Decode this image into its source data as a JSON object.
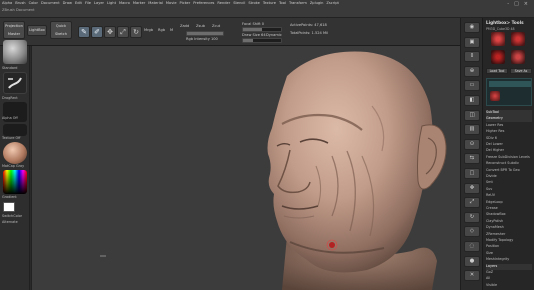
{
  "menubar": {
    "items": [
      "Alpha",
      "Brush",
      "Color",
      "Document",
      "Draw",
      "Edit",
      "File",
      "Layer",
      "Light",
      "Macro",
      "Marker",
      "Material",
      "Movie",
      "Picker",
      "Preferences",
      "Render",
      "Stencil",
      "Stroke",
      "Texture",
      "Tool",
      "Transform",
      "Zplugin",
      "Zscript"
    ],
    "brush_info": "ZBrush Document",
    "window_controls": [
      "-",
      "□",
      "×"
    ]
  },
  "toolbar": {
    "projection_master": "Projection Master",
    "lightbox": "LightBox",
    "quick_sketch": "Quick Sketch",
    "edit": "Edit",
    "draw": "Draw",
    "move": "Move",
    "scale": "Scale",
    "rotate": "Rotate",
    "mrgb": "Mrgb",
    "rgb": "Rgb",
    "m": "M",
    "zadd": "Zadd",
    "zsub": "Zsub",
    "zcut": "Zcut",
    "focal_shift": "Focal Shift 0",
    "draw_size": "Draw Size 64",
    "z_intensity": "Z Intensity 25",
    "rgb_intensity": "Rgb Intensity 100",
    "active_points": "ActivePoints: 47,618",
    "total_points": "TotalPoints: 1.524 Mil",
    "dynamic": "Dynamic"
  },
  "left_shelf": {
    "brush_label": "Standard",
    "stroke_label": "DragRect",
    "alpha_label": "Alpha Off",
    "texture_label": "Texture Off",
    "material_label": "MatCap Gray",
    "gradient_label": "Gradient",
    "switch_color": "SwitchColor",
    "alternate": "Alternate"
  },
  "right_dock": {
    "icons": [
      "BPR",
      "SPix 3",
      "Scroll",
      "Zoom",
      "Actual",
      "AAHalf",
      "Persp",
      "Floor",
      "Local",
      "L.Sym",
      "Frame",
      "Move",
      "Scale",
      "Rotate",
      "PolyF",
      "Transp",
      "Solo",
      "Xpose"
    ]
  },
  "tray": {
    "title": "Lightbox> Tools",
    "subtitle": "PM3D_Cube3D 48",
    "load_tool": "Load Tool",
    "save_as": "Save As",
    "copy_tool": "Copy Tool",
    "import": "Import",
    "export": "Export",
    "clone": "Clone",
    "make_polymesh": "Make PolyMesh3D",
    "goz": "GoZ",
    "all": "All",
    "visible": "Visible",
    "subtool": "SubTool",
    "geometry": "Geometry",
    "layers": "Layers",
    "lower_res": "Lower Res",
    "higher_res": "Higher Res",
    "sdiv": "SDiv 6",
    "del_lower": "Del Lower",
    "del_higher": "Del Higher",
    "freeze_subdiv": "Freeze SubDivision Levels",
    "reconstruct": "Reconstruct Subdiv",
    "convert_bpr": "Convert BPR To Geo",
    "divide": "Divide",
    "smt": "Smt",
    "suv": "Suv",
    "reuv": "ReUV",
    "edge_loop": "EdgeLoop",
    "crease": "Crease",
    "shadowbox": "ShadowBox",
    "claypolish": "ClayPolish",
    "dynamesh": "DynaMesh",
    "zremesher": "ZRemesher",
    "modify_topology": "Modify Topology",
    "position": "Position",
    "size": "Size",
    "meshintegrity": "MeshIntegrity"
  },
  "colors": {
    "skin": "#c5a08f",
    "skin_shadow": "#8f6e60",
    "viewport_bg": "#3c3c3c",
    "accent_red": "#b22222"
  }
}
